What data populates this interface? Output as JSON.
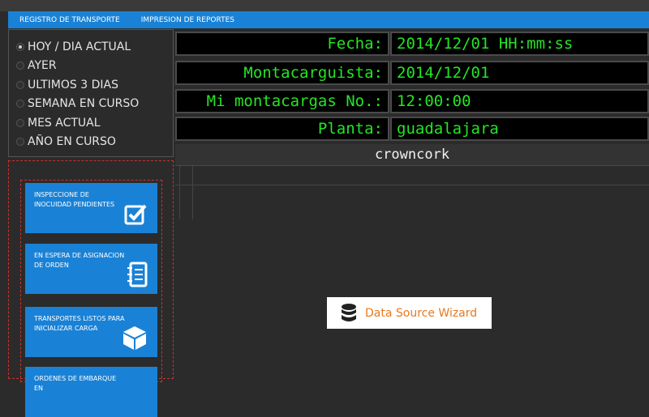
{
  "menu": {
    "items": [
      "REGISTRO DE TRANSPORTE",
      "IMPRESION DE REPORTES"
    ]
  },
  "date_filter": {
    "options": [
      "HOY / DIA ACTUAL",
      "AYER",
      "ULTIMOS 3 DIAS",
      "SEMANA EN CURSO",
      "MES ACTUAL",
      "AÑO EN CURSO"
    ],
    "selected": "HOY / DIA ACTUAL"
  },
  "info": {
    "rows": [
      {
        "label": "Fecha:",
        "value": "2014/12/01 HH:mm:ss"
      },
      {
        "label": "Montacarguista:",
        "value": "2014/12/01"
      },
      {
        "label": "Mi montacargas No.:",
        "value": "12:00:00"
      },
      {
        "label": "Planta:",
        "value": "guadalajara"
      }
    ],
    "text_color": "#25e425"
  },
  "plant_name": "crowncork",
  "tiles": [
    {
      "label": "INSPECCIONE DE INOCUIDAD PENDIENTES",
      "icon": "checkbox-icon"
    },
    {
      "label": "EN ESPERA DE ASIGNACION DE ORDEN",
      "icon": "notebook-icon"
    },
    {
      "label": "TRANSPORTES LISTOS PARA INICIALIZAR CARGA",
      "icon": "box-icon"
    },
    {
      "label": "ORDENES DE EMBARQUE EN",
      "icon": ""
    }
  ],
  "wizard": {
    "label": "Data Source Wizard",
    "icon": "database-icon"
  },
  "colors": {
    "accent": "#1a82d6",
    "dashed_border": "#c9332f",
    "wizard_text": "#e8791d"
  }
}
